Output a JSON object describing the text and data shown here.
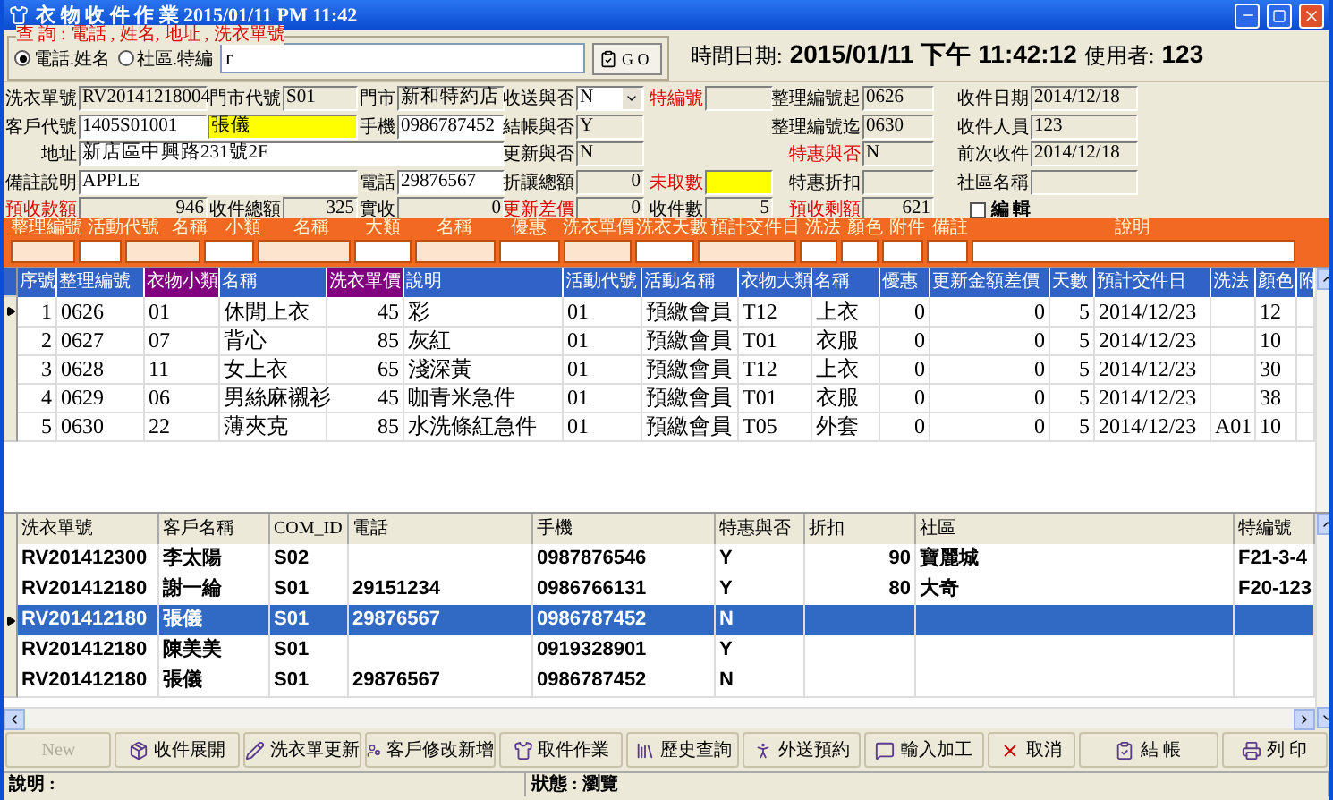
{
  "window": {
    "title": "衣 物 收 件 作 業  2015/01/11 PM 11:42"
  },
  "query": {
    "legend": "查 詢 : 電話 , 姓名, 地址 , 洗衣單號",
    "radios": [
      {
        "label": "電話.姓名",
        "selected": true
      },
      {
        "label": "社區.特編",
        "selected": false
      }
    ],
    "value": "r",
    "go": "G O"
  },
  "clock": {
    "date_label": "時間日期:",
    "date": "2015/01/11",
    "ampm": "下午",
    "time": "11:42:12",
    "user_label": "使用者:",
    "user": "123"
  },
  "form": {
    "fields": [
      {
        "label": "洗衣單號",
        "value": "RV20141218004",
        "kind": "text",
        "readonly": true,
        "alert": false
      },
      {
        "label": "門市代號",
        "value": "S01",
        "kind": "text",
        "readonly": true,
        "alert": false
      },
      {
        "label": "門市",
        "value": "新和特約店",
        "kind": "text",
        "readonly": true,
        "alert": false
      },
      {
        "label": "收送與否",
        "value": "N",
        "kind": "dropdown",
        "readonly": false,
        "alert": false
      },
      {
        "label": "特編號",
        "kind": "text",
        "readonly": true,
        "alert": true
      },
      {
        "label": "整理編號起",
        "value": "0626",
        "kind": "text",
        "readonly": true,
        "alert": false
      },
      {
        "label": "收件日期",
        "value": "2014/12/18",
        "kind": "text",
        "readonly": true,
        "alert": false
      },
      {
        "label": "客戶代號",
        "value": "1405S01001",
        "kind": "text",
        "readonly": false,
        "alert": false
      },
      {
        "value": "張儀",
        "kind": "highlight"
      },
      {
        "label": "手機",
        "value": "0986787452",
        "kind": "text",
        "readonly": false,
        "alert": false
      },
      {
        "label": "結帳與否",
        "value": "Y",
        "kind": "text",
        "readonly": true,
        "alert": false
      },
      {
        "label": "整理編號迄",
        "value": "0630",
        "kind": "text",
        "readonly": true,
        "alert": false
      },
      {
        "label": "收件人員",
        "value": "123",
        "kind": "text",
        "readonly": true,
        "alert": false
      },
      {
        "label": "地址",
        "value": "新店區中興路231號2F",
        "kind": "text",
        "readonly": false,
        "alert": false
      },
      {
        "label": "更新與否",
        "value": "N",
        "kind": "text",
        "readonly": true,
        "alert": false
      },
      {
        "label": "特惠與否",
        "value": "N",
        "kind": "text",
        "readonly": true,
        "alert": true
      },
      {
        "label": "前次收件",
        "value": "2014/12/18",
        "kind": "text",
        "readonly": true,
        "alert": false
      },
      {
        "label": "備註說明",
        "value": "APPLE",
        "kind": "text",
        "readonly": false,
        "alert": false
      },
      {
        "label": "電話",
        "value": "29876567",
        "kind": "text",
        "readonly": false,
        "alert": false
      },
      {
        "label": "折讓總額",
        "value": "0",
        "kind": "number",
        "readonly": true,
        "alert": false
      },
      {
        "label": "未取數",
        "kind": "highlight",
        "alert": true
      },
      {
        "label": "特惠折扣",
        "kind": "text",
        "readonly": true,
        "alert": false
      },
      {
        "label": "社區名稱",
        "kind": "text",
        "readonly": true,
        "alert": false
      },
      {
        "label": "預收款額",
        "value": "946",
        "kind": "number",
        "readonly": true,
        "alert": true
      },
      {
        "label": "收件總額",
        "value": "325",
        "kind": "number",
        "readonly": true,
        "alert": false
      },
      {
        "label": "實收",
        "value": "0",
        "kind": "number",
        "readonly": true,
        "alert": false
      },
      {
        "label": "更新差價",
        "value": "0",
        "kind": "number",
        "readonly": true,
        "alert": true
      },
      {
        "label": "收件數",
        "value": "5",
        "kind": "number",
        "readonly": true,
        "alert": false
      },
      {
        "label": "預收剩額",
        "value": "621",
        "kind": "number",
        "readonly": true,
        "alert": true
      },
      {
        "label": "編輯",
        "kind": "checkbox",
        "checked": false
      }
    ]
  },
  "entry_bar": {
    "columns": [
      {
        "label": "整理編號",
        "readonly": true
      },
      {
        "label": "活動代號",
        "readonly": false
      },
      {
        "label": "名稱",
        "readonly": true
      },
      {
        "label": "小類",
        "readonly": false
      },
      {
        "label": "名稱",
        "readonly": true
      },
      {
        "label": "大類",
        "readonly": false
      },
      {
        "label": "名稱",
        "readonly": true
      },
      {
        "label": "優惠",
        "readonly": false
      },
      {
        "label": "洗衣單價",
        "readonly": true
      },
      {
        "label": "洗衣天數",
        "readonly": false
      },
      {
        "label": "預計交件日",
        "readonly": true
      },
      {
        "label": "洗法",
        "readonly": false
      },
      {
        "label": "顏色",
        "readonly": false
      },
      {
        "label": "附件",
        "readonly": false
      },
      {
        "label": "備註",
        "readonly": false
      },
      {
        "label": "說明",
        "readonly": false
      }
    ]
  },
  "items_grid": {
    "columns": [
      {
        "label": "序號",
        "kind": "number",
        "color": "#3163c6"
      },
      {
        "label": "整理編號",
        "kind": "text",
        "color": "#3163c6"
      },
      {
        "label": "衣物小類",
        "kind": "text",
        "color": "#800080"
      },
      {
        "label": "名稱",
        "kind": "text",
        "color": "#3163c6"
      },
      {
        "label": "洗衣單價",
        "kind": "number",
        "color": "#800080"
      },
      {
        "label": "說明",
        "kind": "text",
        "color": "#3163c6"
      },
      {
        "label": "活動代號",
        "kind": "text",
        "color": "#3163c6"
      },
      {
        "label": "活動名稱",
        "kind": "text",
        "color": "#3163c6"
      },
      {
        "label": "衣物大類",
        "kind": "text",
        "color": "#3163c6"
      },
      {
        "label": "名稱",
        "kind": "text",
        "color": "#3163c6"
      },
      {
        "label": "優惠",
        "kind": "number",
        "color": "#3163c6"
      },
      {
        "label": "更新金額差價",
        "kind": "number",
        "color": "#3163c6"
      },
      {
        "label": "天數",
        "kind": "number",
        "color": "#3163c6"
      },
      {
        "label": "預計交件日",
        "kind": "text",
        "color": "#3163c6"
      },
      {
        "label": "洗法",
        "kind": "text",
        "color": "#3163c6"
      },
      {
        "label": "顏色",
        "kind": "text",
        "color": "#3163c6"
      },
      {
        "label": "附",
        "kind": "text",
        "color": "#3163c6"
      }
    ],
    "rows": [
      {
        "selected": true,
        "cells": [
          "1",
          "0626",
          "01",
          "休閒上衣",
          "45",
          "彩",
          "01",
          "預繳會員",
          "T12",
          "上衣",
          "0",
          "0",
          "5",
          "2014/12/23",
          null,
          "12",
          null
        ]
      },
      {
        "selected": false,
        "cells": [
          "2",
          "0627",
          "07",
          "背心",
          "85",
          "灰紅",
          "01",
          "預繳會員",
          "T01",
          "衣服",
          "0",
          "0",
          "5",
          "2014/12/23",
          null,
          "10",
          null
        ]
      },
      {
        "selected": false,
        "cells": [
          "3",
          "0628",
          "11",
          "女上衣",
          "65",
          "淺深黃",
          "01",
          "預繳會員",
          "T12",
          "上衣",
          "0",
          "0",
          "5",
          "2014/12/23",
          null,
          "30",
          null
        ]
      },
      {
        "selected": false,
        "cells": [
          "4",
          "0629",
          "06",
          "男絲麻襯衫",
          "45",
          "咖青米急件",
          "01",
          "預繳會員",
          "T01",
          "衣服",
          "0",
          "0",
          "5",
          "2014/12/23",
          null,
          "38",
          null
        ]
      },
      {
        "selected": false,
        "cells": [
          "5",
          "0630",
          "22",
          "薄夾克",
          "85",
          "水洗條紅急件",
          "01",
          "預繳會員",
          "T05",
          "外套",
          "0",
          "0",
          "5",
          "2014/12/23",
          "A01",
          "10",
          null
        ]
      }
    ]
  },
  "orders_grid": {
    "columns": [
      "洗衣單號",
      "客戶名稱",
      "COM_ID",
      "電話",
      "手機",
      "特惠與否",
      "折扣",
      "社區",
      "特編號"
    ],
    "rows": [
      {
        "selected": false,
        "cells": [
          "RV201412300",
          "李太陽",
          "S02",
          null,
          "0987876546",
          "Y",
          "90",
          "寶麗城",
          "F21-3-4"
        ]
      },
      {
        "selected": false,
        "cells": [
          "RV201412180",
          "謝一綸",
          "S01",
          "29151234",
          "0986766131",
          "Y",
          "80",
          "大奇",
          "F20-123"
        ]
      },
      {
        "selected": true,
        "cells": [
          "RV201412180",
          "張儀",
          "S01",
          "29876567",
          "0986787452",
          "N",
          null,
          null,
          null
        ]
      },
      {
        "selected": false,
        "cells": [
          "RV201412180",
          "陳美美",
          "S01",
          null,
          "0919328901",
          "Y",
          null,
          null,
          null
        ]
      },
      {
        "selected": false,
        "cells": [
          "RV201412180",
          "張儀",
          "S01",
          "29876567",
          "0986787452",
          "N",
          null,
          null,
          null
        ]
      }
    ]
  },
  "buttons": [
    {
      "label": "New",
      "disabled": true
    },
    {
      "label": "收件展開",
      "disabled": false
    },
    {
      "label": "洗衣單更新",
      "disabled": false
    },
    {
      "label": "客戶修改新增",
      "disabled": false
    },
    {
      "label": "取件作業",
      "disabled": false
    },
    {
      "label": "歷史查詢",
      "disabled": false
    },
    {
      "label": "外送預約",
      "disabled": false
    },
    {
      "label": "輸入加工",
      "disabled": false
    },
    {
      "label": "取消",
      "disabled": false
    },
    {
      "label": "結 帳",
      "disabled": false
    },
    {
      "label": "列 印",
      "disabled": false
    }
  ],
  "status_bar": {
    "note": "說明 :",
    "state": "狀態 : 瀏覽"
  }
}
